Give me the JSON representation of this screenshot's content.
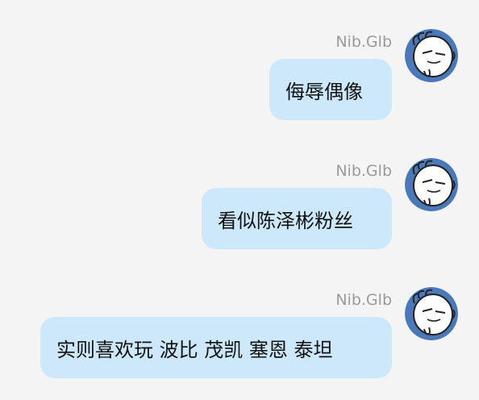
{
  "messages": [
    {
      "sender": "Nib.Glb",
      "text": "侮辱偶像"
    },
    {
      "sender": "Nib.Glb",
      "text": "看似陈泽彬粉丝"
    },
    {
      "sender": "Nib.Glb",
      "text": "实则喜欢玩 波比 茂凯 塞恩 泰坦"
    }
  ],
  "colors": {
    "background": "#f4f4f4",
    "bubble": "#cde8fb",
    "sender_text": "#9a9a9a",
    "message_text": "#111111",
    "avatar_blue": "#4a78b8"
  },
  "icons": {
    "avatar": "cartoon-face-avatar-icon"
  }
}
